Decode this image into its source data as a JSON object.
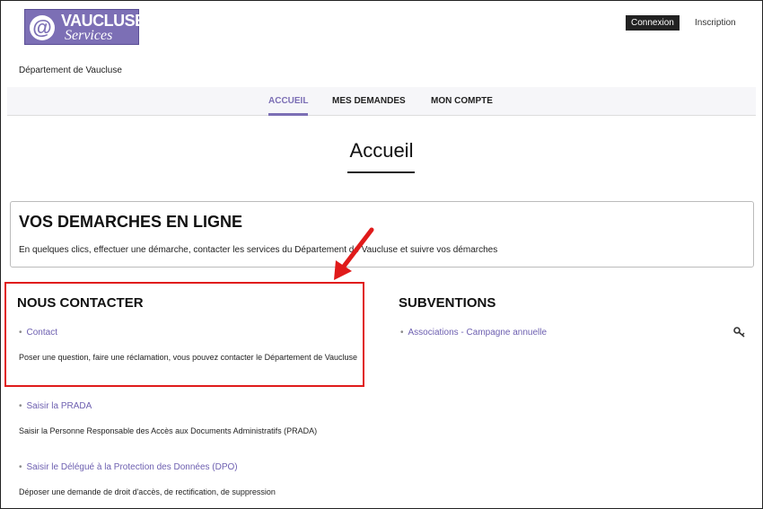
{
  "header": {
    "logo": {
      "at": "@",
      "word": "VAUCLUSE",
      "sub": "Services"
    },
    "connexion_label": "Connexion",
    "inscription_label": "Inscription",
    "department": "Département de Vaucluse"
  },
  "nav": {
    "items": [
      {
        "label": "ACCUEIL",
        "active": true
      },
      {
        "label": "MES DEMANDES",
        "active": false
      },
      {
        "label": "MON COMPTE",
        "active": false
      }
    ]
  },
  "page": {
    "title": "Accueil"
  },
  "demarches": {
    "title": "VOS DEMARCHES EN LIGNE",
    "text": "En quelques clics, effectuer une démarche, contacter les services du Département de Vaucluse et suivre vos démarches"
  },
  "contact_section": {
    "title": "NOUS CONTACTER",
    "items": [
      {
        "link": "Contact",
        "desc": "Poser une question, faire une réclamation, vous pouvez contacter le Département de Vaucluse"
      },
      {
        "link": "Saisir la PRADA",
        "desc": "Saisir la Personne Responsable des Accès aux Documents Administratifs (PRADA)"
      },
      {
        "link": "Saisir le Délégué à la Protection des Données (DPO)",
        "desc": "Déposer une demande de droit d'accès, de rectification, de suppression"
      }
    ]
  },
  "subventions": {
    "title": "SUBVENTIONS",
    "items": [
      {
        "link": "Associations - Campagne annuelle"
      }
    ]
  },
  "icons": {
    "bullet": "•",
    "key": "key-icon",
    "arrow": "red-arrow"
  },
  "colors": {
    "accent": "#7c6fb5",
    "link": "#6d5fb0",
    "highlight": "#e01b1b",
    "dark_button": "#222222"
  }
}
